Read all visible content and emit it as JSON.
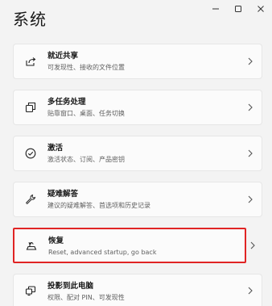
{
  "page": {
    "title": "系统"
  },
  "window_controls": {
    "minimize": "minimize-icon",
    "maximize": "maximize-icon",
    "close": "close-icon"
  },
  "items": [
    {
      "id": "nearby-sharing",
      "icon": "share-icon",
      "label": "就近共享",
      "desc": "可发现性、接收的文件位置"
    },
    {
      "id": "multitasking",
      "icon": "multitasking-icon",
      "label": "多任务处理",
      "desc": "贴靠窗口、桌面、任务切换"
    },
    {
      "id": "activation",
      "icon": "check-circle-icon",
      "label": "激活",
      "desc": "激活状态、订阅、产品密钥"
    },
    {
      "id": "troubleshoot",
      "icon": "wrench-icon",
      "label": "疑难解答",
      "desc": "建议的疑难解答、首选项和历史记录"
    },
    {
      "id": "recovery",
      "icon": "recovery-icon",
      "label": "恢复",
      "desc": "Reset, advanced startup, go back"
    },
    {
      "id": "projecting",
      "icon": "projecting-icon",
      "label": "投影到此电脑",
      "desc": "权限、配对 PIN、可发现性"
    }
  ],
  "colors": {
    "background": "#f3f3f3",
    "card": "#fbfbfb",
    "highlight_border": "#e02424"
  }
}
